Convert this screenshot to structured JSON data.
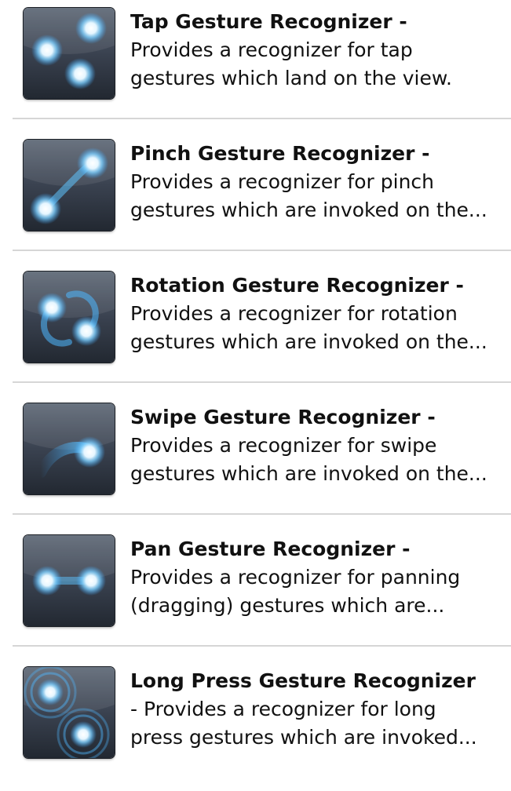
{
  "items": [
    {
      "icon": "tap-gesture-icon",
      "title": "Tap Gesture Recognizer",
      "separator": " -",
      "lines": [
        "Provides a recognizer for tap",
        "gestures which land on the view."
      ]
    },
    {
      "icon": "pinch-gesture-icon",
      "title": "Pinch Gesture Recognizer",
      "separator": " -",
      "lines": [
        "Provides a recognizer for pinch",
        "gestures which are invoked on the..."
      ]
    },
    {
      "icon": "rotation-gesture-icon",
      "title": "Rotation Gesture Recognizer",
      "separator": " -",
      "lines": [
        "Provides a recognizer for rotation",
        "gestures which are invoked on the..."
      ]
    },
    {
      "icon": "swipe-gesture-icon",
      "title": "Swipe Gesture Recognizer",
      "separator": " -",
      "lines": [
        "Provides a recognizer for swipe",
        "gestures which are invoked on the..."
      ]
    },
    {
      "icon": "pan-gesture-icon",
      "title": "Pan Gesture Recognizer",
      "separator": " -",
      "lines": [
        "Provides a recognizer for panning",
        "(dragging) gestures which are..."
      ]
    },
    {
      "icon": "long-press-gesture-icon",
      "title": "Long Press Gesture Recognizer",
      "separator": "",
      "lines": [
        "- Provides a recognizer for long",
        "press gestures which are invoked..."
      ]
    }
  ]
}
